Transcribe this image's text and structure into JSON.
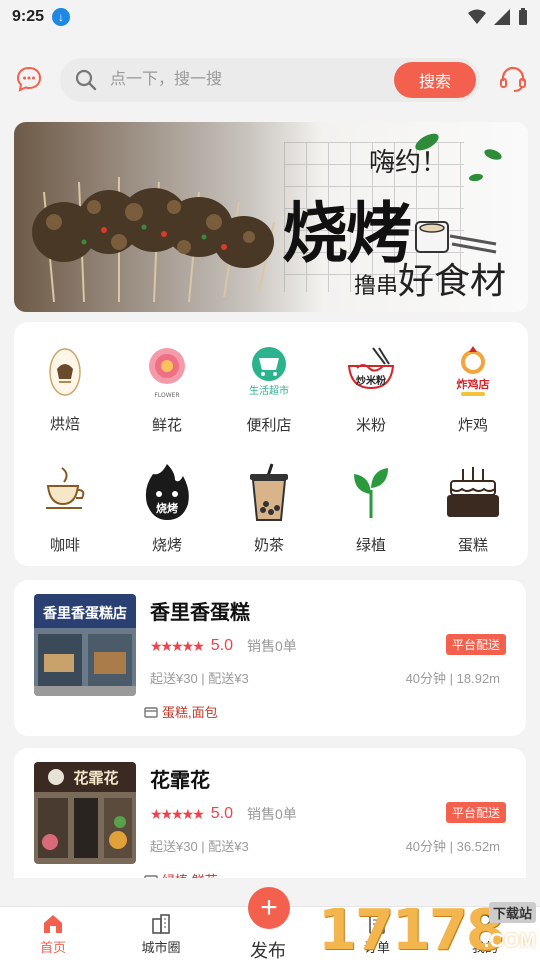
{
  "status_bar": {
    "time": "9:25"
  },
  "search": {
    "placeholder": "点一下，搜一搜",
    "button": "搜索"
  },
  "banner": {
    "hey": "嗨约！",
    "title": "烧烤",
    "sub_small": "撸串",
    "sub_big": "好食材"
  },
  "categories": [
    {
      "label": "烘焙",
      "icon": "bakery-icon"
    },
    {
      "label": "鲜花",
      "icon": "flower-icon",
      "icon_text": "FLOWER"
    },
    {
      "label": "便利店",
      "icon": "convenience-store-icon",
      "icon_text": "生活超市"
    },
    {
      "label": "米粉",
      "icon": "rice-noodle-icon",
      "icon_text": "炒米粉"
    },
    {
      "label": "炸鸡",
      "icon": "fried-chicken-icon",
      "icon_text": "炸鸡店"
    },
    {
      "label": "咖啡",
      "icon": "coffee-icon"
    },
    {
      "label": "烧烤",
      "icon": "bbq-icon",
      "icon_text": "烧烤"
    },
    {
      "label": "奶茶",
      "icon": "milk-tea-icon"
    },
    {
      "label": "绿植",
      "icon": "plant-icon"
    },
    {
      "label": "蛋糕",
      "icon": "cake-icon"
    }
  ],
  "shops": [
    {
      "name": "香里香蛋糕",
      "sign": "香里香蛋糕店",
      "stars": "★★★★★",
      "rating": "5.0",
      "sales": "销售0单",
      "badge": "平台配送",
      "meta": "起送¥30 | 配送¥3",
      "distance": "40分钟 | 18.92m",
      "tags": "蛋糕,面包"
    },
    {
      "name": "花霏花",
      "sign": "花霏花",
      "stars": "★★★★★",
      "rating": "5.0",
      "sales": "销售0单",
      "badge": "平台配送",
      "meta": "起送¥30 | 配送¥3",
      "distance": "40分钟 | 36.52m",
      "tags": "绿植,鲜花"
    }
  ],
  "tabbar": {
    "home": "首页",
    "city": "城市圈",
    "publish": "发布",
    "orders": "订单",
    "mine": "我的"
  },
  "watermark": {
    "num": "17178",
    "site": "下载站",
    "domain": ".COM"
  },
  "colors": {
    "accent": "#f4604e",
    "star": "#f2414b"
  }
}
